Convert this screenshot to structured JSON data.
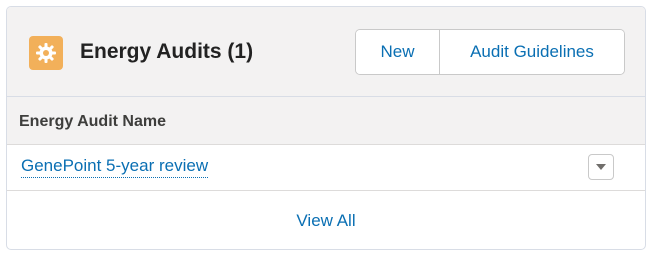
{
  "card": {
    "icon": "gear-icon",
    "title": "Energy Audits (1)",
    "accent_color": "#f2b05a",
    "link_color": "#0a6fb3"
  },
  "actions": {
    "new_label": "New",
    "guidelines_label": "Audit Guidelines"
  },
  "table": {
    "columns": [
      "Energy Audit Name"
    ],
    "rows": [
      {
        "name": "GenePoint 5-year review",
        "menu_icon": "chevron-down-icon"
      }
    ]
  },
  "footer": {
    "view_all_label": "View All"
  }
}
